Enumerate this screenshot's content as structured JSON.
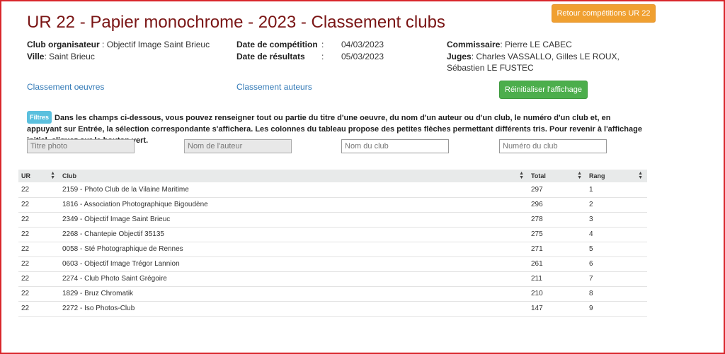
{
  "page": {
    "title": "UR 22 - Papier monochrome - 2023 - Classement clubs",
    "back_button": "Retour compétitions UR 22",
    "reset_button": "Réinitialiser l'affichage"
  },
  "info": {
    "club_label": "Club organisateur",
    "club_value": ": Objectif Image Saint Brieuc",
    "ville_label": "Ville",
    "ville_value": ": Saint Brieuc",
    "date_comp_label": "Date de compétition",
    "date_comp_colon": ":",
    "date_comp_value": "04/03/2023",
    "date_res_label": "Date de résultats",
    "date_res_colon": ":",
    "date_res_value": "05/03/2023",
    "commissaire_label": "Commissaire",
    "commissaire_value": ": Pierre LE CABEC",
    "juges_label": "Juges",
    "juges_value": ": Charles VASSALLO, Gilles LE ROUX,",
    "juges_value2": "Sébastien LE FUSTEC"
  },
  "links": {
    "oeuvres": "Classement oeuvres",
    "auteurs": "Classement auteurs"
  },
  "filters": {
    "badge": "Filtres",
    "text": "Dans les champs ci-dessous, vous pouvez renseigner tout ou partie du titre d'une oeuvre, du nom d'un auteur ou d'un club, le numéro d'un club et, en appuyant sur Entrée, la sélection correspondante s'affichera. Les colonnes du tableau propose des petites flèches permettant différents tris. Pour revenir à l'affichage initial, cliquez sur le bouton vert.",
    "titre_placeholder": "Titre photo",
    "auteur_placeholder": "Nom de l'auteur",
    "club_placeholder": "Nom du club",
    "numero_placeholder": "Numéro du club"
  },
  "table": {
    "headers": [
      "UR",
      "Club",
      "Total",
      "Rang"
    ],
    "rows": [
      [
        "22",
        "2159 - Photo Club de la Vilaine Maritime",
        "297",
        "1"
      ],
      [
        "22",
        "1816 - Association Photographique Bigoudène",
        "296",
        "2"
      ],
      [
        "22",
        "2349 - Objectif Image Saint Brieuc",
        "278",
        "3"
      ],
      [
        "22",
        "2268 - Chantepie Objectif 35135",
        "275",
        "4"
      ],
      [
        "22",
        "0058 - Sté Photographique de Rennes",
        "271",
        "5"
      ],
      [
        "22",
        "0603 - Objectif Image Trégor Lannion",
        "261",
        "6"
      ],
      [
        "22",
        "2274 - Club Photo Saint Grégoire",
        "211",
        "7"
      ],
      [
        "22",
        "1829 - Bruz Chromatik",
        "210",
        "8"
      ],
      [
        "22",
        "2272 - Iso Photos-Club",
        "147",
        "9"
      ]
    ]
  },
  "colors": {
    "title": "#7a1515",
    "back_button": "#f0a030",
    "reset_button": "#4cae4c",
    "link": "#337ab7",
    "badge": "#5bc0de",
    "frame": "#d9262b"
  }
}
